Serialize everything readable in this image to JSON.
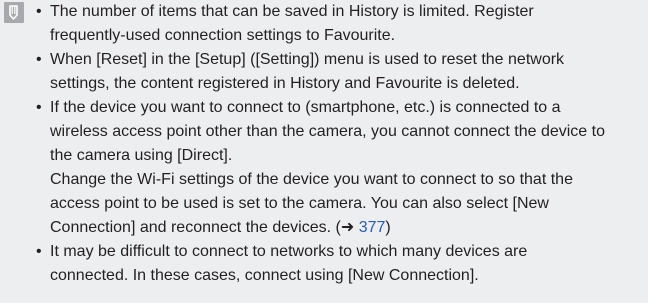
{
  "icon": "memo-note-icon",
  "link_color": "#2a5db0",
  "notes": [
    {
      "lines": [
        "The number of items that can be saved in History is limited. Register",
        "frequently-used connection settings to Favourite."
      ]
    },
    {
      "lines": [
        "When [Reset] in the [Setup] ([Setting]) menu is used to reset the network",
        "settings, the content registered in History and Favourite is deleted."
      ]
    },
    {
      "lines": [
        "If the device you want to connect to (smartphone, etc.) is connected to a",
        "wireless access point other than the camera, you cannot connect the device to",
        "the camera using [Direct].",
        "Change the Wi-Fi settings of the device you want to connect to so that the",
        "access point to be used is set to the camera. You can also select [New"
      ],
      "last_line_prefix": "Connection] and reconnect the devices. (",
      "last_line_arrow": "➜",
      "last_line_link": "377",
      "last_line_suffix": ")"
    },
    {
      "lines": [
        "It may be difficult to connect to networks to which many devices are",
        "connected. In these cases, connect using [New Connection]."
      ]
    }
  ]
}
